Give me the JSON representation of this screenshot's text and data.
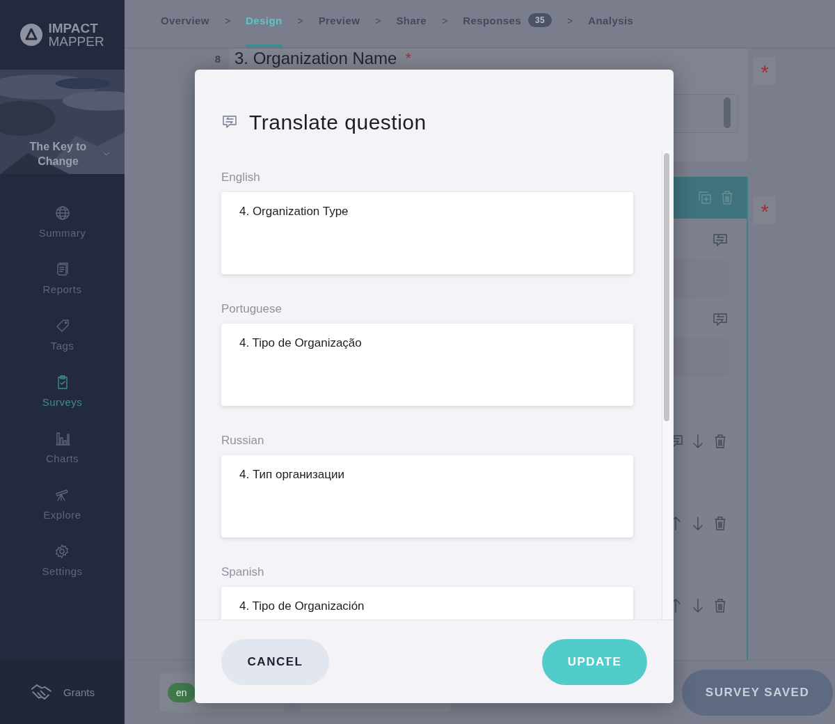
{
  "sidebar": {
    "logo": {
      "line_1": "IMPACT",
      "line_2": "MAPPER"
    },
    "project": {
      "name": "The Key to Change",
      "kind": "picture"
    },
    "items": [
      {
        "label": "Summary",
        "selected": false
      },
      {
        "label": "Reports",
        "selected": false
      },
      {
        "label": "Tags",
        "selected": false
      },
      {
        "label": "Surveys",
        "selected": true
      },
      {
        "label": "Charts",
        "selected": false
      },
      {
        "label": "Explore",
        "selected": false
      },
      {
        "label": "Settings",
        "selected": false
      }
    ],
    "footer_item": {
      "label": "Grants"
    }
  },
  "steps": [
    {
      "label": "Overview",
      "selected": false
    },
    {
      "label": "Design",
      "selected": true
    },
    {
      "label": "Preview",
      "selected": false
    },
    {
      "label": "Share",
      "selected": false
    },
    {
      "label": "Responses",
      "selected": false,
      "badge": "35"
    },
    {
      "label": "Analysis",
      "selected": false
    }
  ],
  "step_separator": ">",
  "editor": {
    "question_number": "8",
    "question_title": "3. Organization Name",
    "required_mark": "*",
    "side_marks": [
      "*",
      "*"
    ]
  },
  "bottom_bar": {
    "language": "en",
    "save_button": {
      "label": "SURVEY SAVED",
      "disabled": true
    }
  },
  "dialog": {
    "title": "Translate question",
    "translations": [
      {
        "language": "English",
        "text": "4. Organization Type"
      },
      {
        "language": "Portuguese",
        "text": "4. Tipo de Organização"
      },
      {
        "language": "Russian",
        "text": "4. Тип организации"
      },
      {
        "language": "Spanish",
        "text": "4. Tipo de Organización"
      }
    ],
    "buttons": [
      {
        "label": "CANCEL",
        "kind": "secondary"
      },
      {
        "label": "UPDATE",
        "kind": "primary"
      }
    ]
  }
}
